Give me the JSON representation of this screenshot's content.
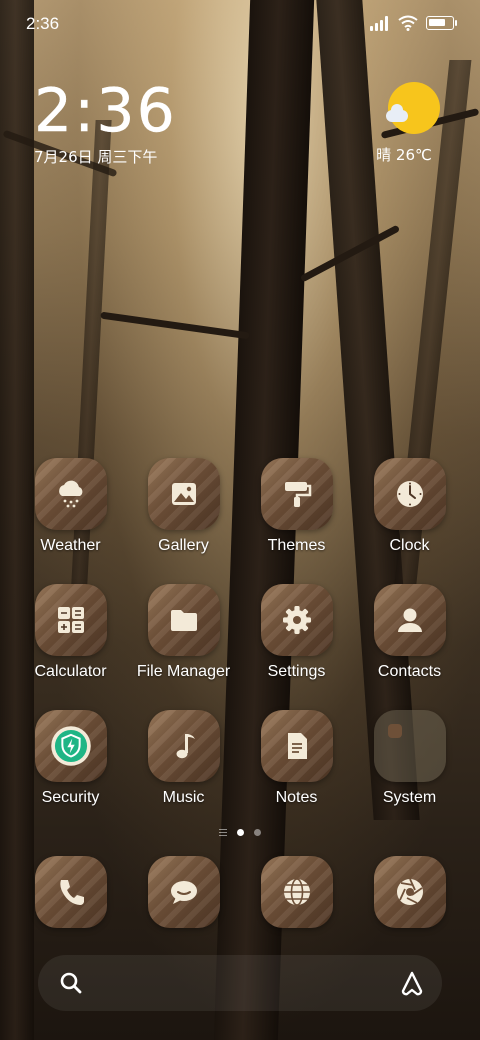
{
  "status_bar": {
    "time": "2:36",
    "battery_level": 0.75
  },
  "clock_widget": {
    "time": "2:36",
    "date": "7月26日 周三下午"
  },
  "weather_widget": {
    "condition_temp": "晴 26℃",
    "icon": "sun-cloud-icon"
  },
  "apps": [
    [
      {
        "label": "Weather",
        "icon": "weather-icon"
      },
      {
        "label": "Gallery",
        "icon": "gallery-icon"
      },
      {
        "label": "Themes",
        "icon": "paint-roller-icon"
      },
      {
        "label": "Clock",
        "icon": "clock-icon"
      }
    ],
    [
      {
        "label": "Calculator",
        "icon": "calculator-icon"
      },
      {
        "label": "File Manager",
        "icon": "folder-icon"
      },
      {
        "label": "Settings",
        "icon": "gear-icon"
      },
      {
        "label": "Contacts",
        "icon": "person-icon"
      }
    ],
    [
      {
        "label": "Security",
        "icon": "shield-bolt-icon"
      },
      {
        "label": "Music",
        "icon": "music-note-icon"
      },
      {
        "label": "Notes",
        "icon": "note-icon"
      },
      {
        "label": "System",
        "icon": "folder-icon"
      }
    ]
  ],
  "page_indicator": {
    "pages": 2,
    "current": 1
  },
  "dock": [
    {
      "icon": "phone-icon"
    },
    {
      "icon": "message-icon"
    },
    {
      "icon": "browser-icon"
    },
    {
      "icon": "camera-icon"
    }
  ],
  "search_bar": {
    "left_icon": "search-icon",
    "right_icon": "assistant-icon"
  },
  "colors": {
    "icon_wood": "#6e5038",
    "sun": "#f7c51c",
    "security_green": "#1fb585"
  }
}
